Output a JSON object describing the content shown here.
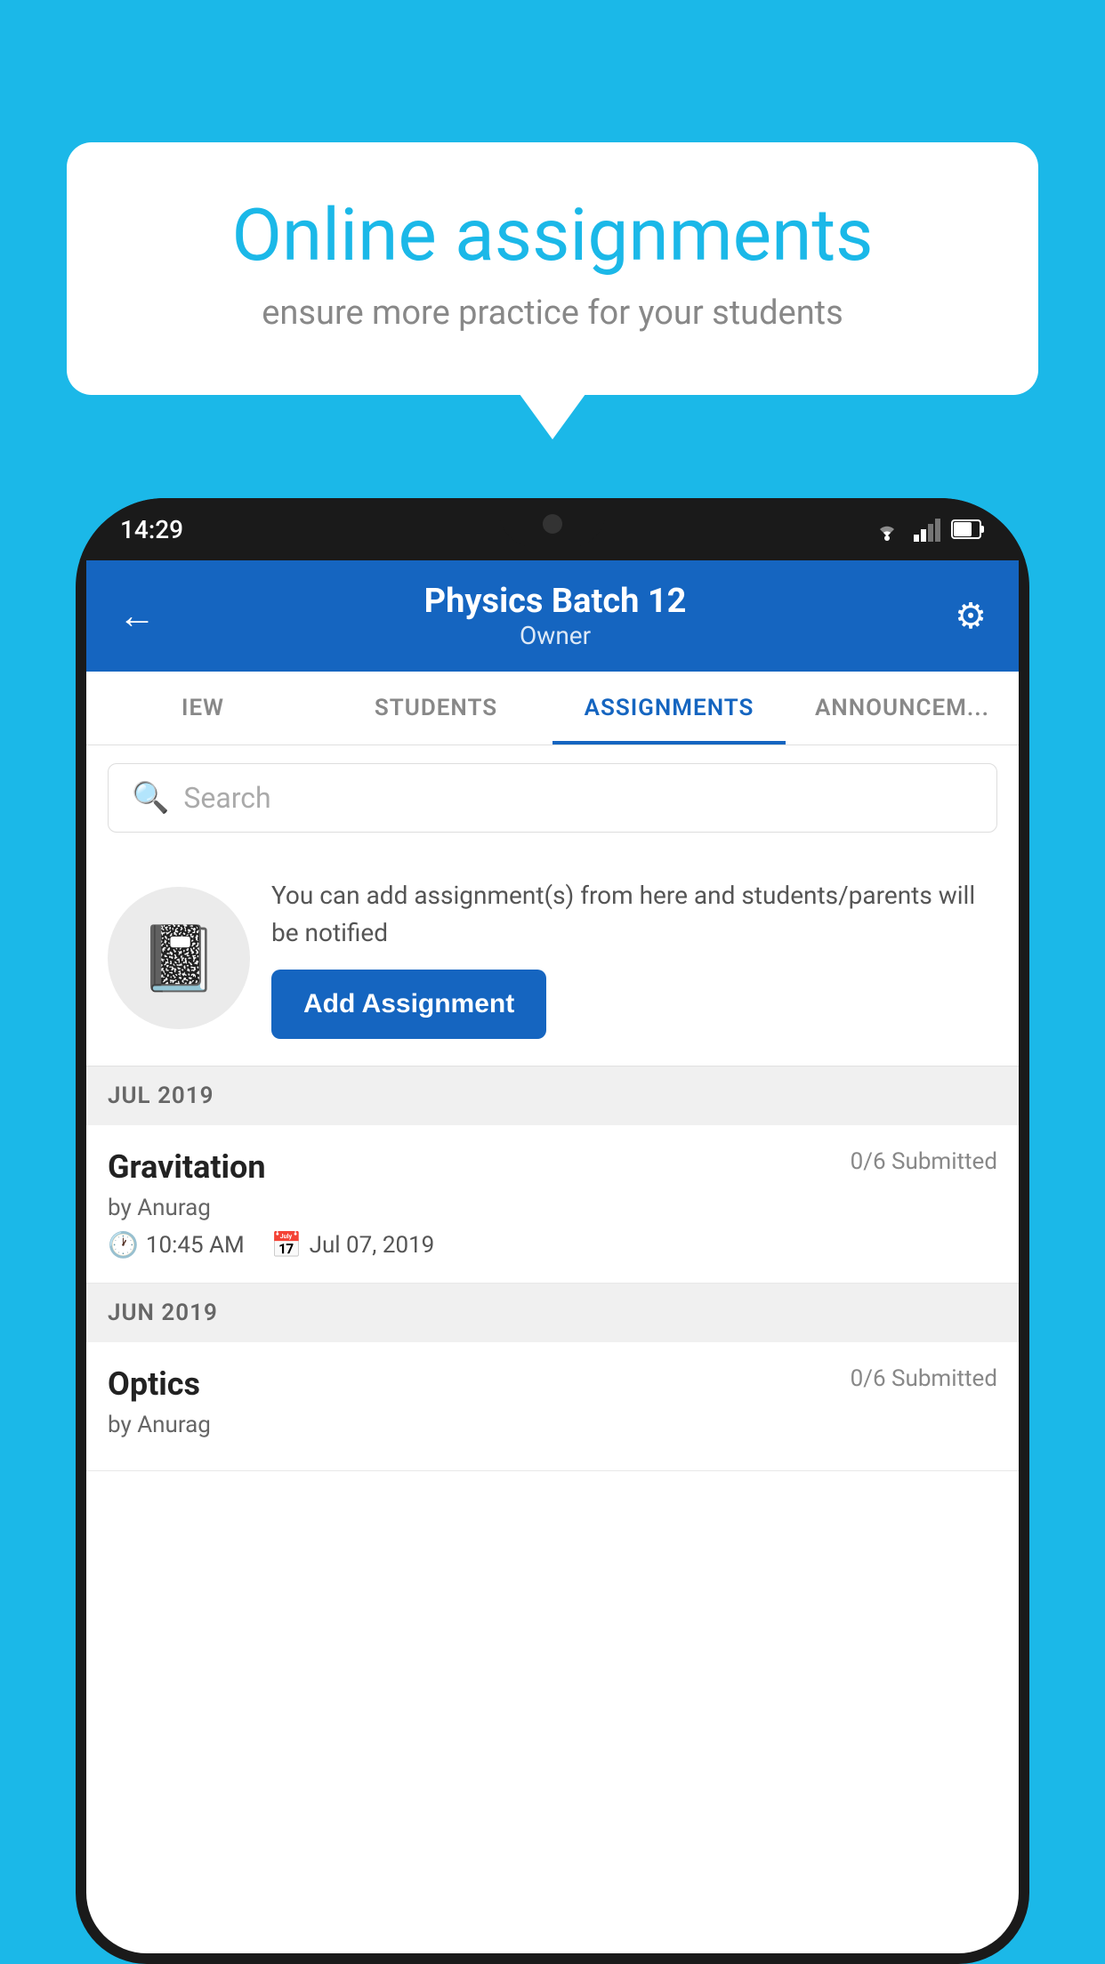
{
  "background_color": "#1BB8E8",
  "speech_bubble": {
    "title": "Online assignments",
    "subtitle": "ensure more practice for your students"
  },
  "phone": {
    "status_bar": {
      "time": "14:29"
    },
    "header": {
      "title": "Physics Batch 12",
      "subtitle": "Owner",
      "back_label": "←",
      "settings_label": "⚙"
    },
    "tabs": [
      {
        "label": "IEW",
        "active": false
      },
      {
        "label": "STUDENTS",
        "active": false
      },
      {
        "label": "ASSIGNMENTS",
        "active": true
      },
      {
        "label": "ANNOUNCEM...",
        "active": false
      }
    ],
    "search": {
      "placeholder": "Search"
    },
    "promo": {
      "description": "You can add assignment(s) from here and students/parents will be notified",
      "button_label": "Add Assignment"
    },
    "sections": [
      {
        "month_label": "JUL 2019",
        "assignments": [
          {
            "name": "Gravitation",
            "submitted": "0/6 Submitted",
            "by": "by Anurag",
            "time": "10:45 AM",
            "date": "Jul 07, 2019"
          }
        ]
      },
      {
        "month_label": "JUN 2019",
        "assignments": [
          {
            "name": "Optics",
            "submitted": "0/6 Submitted",
            "by": "by Anurag",
            "time": "",
            "date": ""
          }
        ]
      }
    ]
  }
}
